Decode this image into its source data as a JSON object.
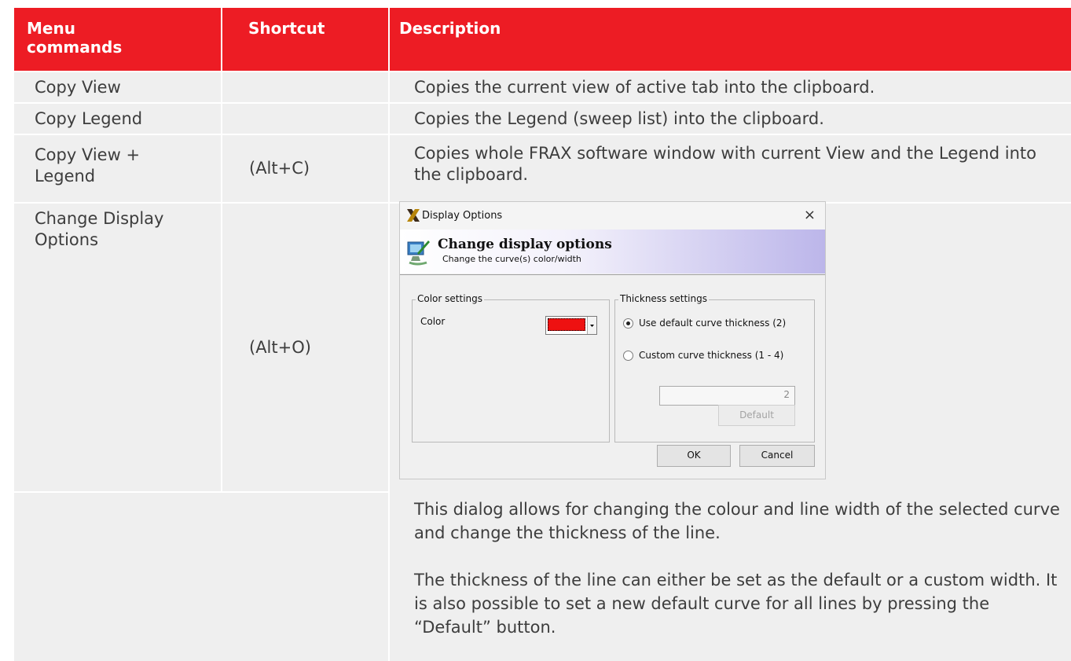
{
  "header": {
    "col1": "Menu commands",
    "col2": "Shortcut",
    "col3": "Description"
  },
  "rows": [
    {
      "command": "Copy View",
      "shortcut": "",
      "description": "Copies the current view of active tab into the clipboard."
    },
    {
      "command": "Copy Legend",
      "shortcut": "",
      "description": "Copies the Legend (sweep list) into the clipboard."
    },
    {
      "command": "Copy View + Legend",
      "shortcut": "(Alt+C)",
      "description": "Copies whole FRAX software window with current View and the Legend into the clipboard."
    },
    {
      "command": "Change Display Options",
      "shortcut": "(Alt+O)",
      "description": ""
    }
  ],
  "dialog": {
    "title": "Display Options",
    "close_glyph": "×",
    "banner_title": "Change display options",
    "banner_subtitle": "Change the curve(s) color/width",
    "color_group": {
      "label": "Color settings",
      "color_label": "Color",
      "color_value": "#ee1111"
    },
    "thickness_group": {
      "label": "Thickness settings",
      "option_default": "Use default curve thickness (2)",
      "option_custom": "Custom curve thickness (1 - 4)",
      "value": "2",
      "default_button": "Default"
    },
    "ok_button": "OK",
    "cancel_button": "Cancel"
  },
  "paragraphs": [
    "This dialog allows for changing the colour and line width of the selected curve and change the thickness of the line.",
    "The thickness of the line can either be set as the default or a custom width. It is also possible to set a new default curve for all lines by pressing the “Default” button."
  ],
  "colors": {
    "header": "#ed1c24",
    "cell": "#efefef"
  },
  "icons": {
    "app": "frax-logo-icon",
    "banner": "display-settings-icon"
  }
}
